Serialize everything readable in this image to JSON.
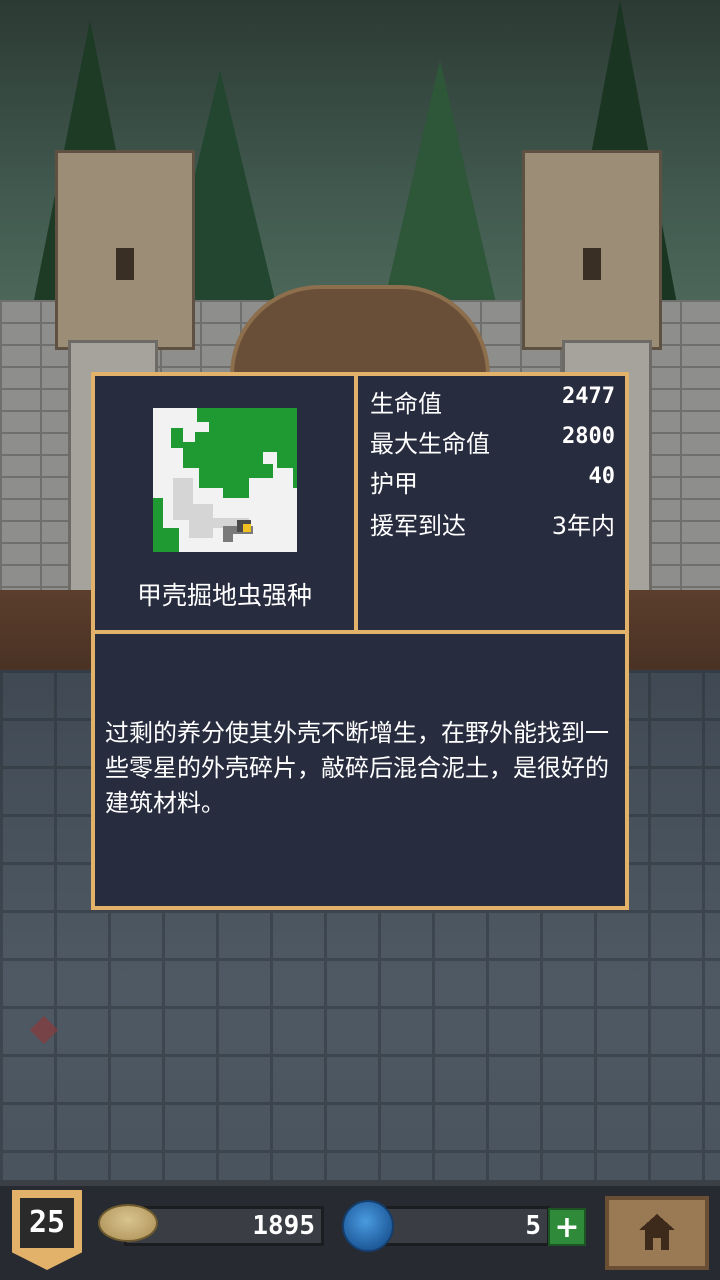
{
  "enemy": {
    "name": "甲壳掘地虫强种",
    "portrait_icon": "armored-burrower-bug-icon"
  },
  "stats": [
    {
      "label": "生命值",
      "value": "2477"
    },
    {
      "label": "最大生命值",
      "value": "2800"
    },
    {
      "label": "护甲",
      "value": "40"
    },
    {
      "label": "援军到达",
      "value": "3年内"
    }
  ],
  "description": "过剩的养分使其外壳不断增生，在野外能找到一些零星的外壳碎片，敲碎后混合泥土，是很好的建筑材料。",
  "hud": {
    "level": "25",
    "gold": "1895",
    "gems": "5",
    "plus_label": "+"
  },
  "colors": {
    "panel_border": "#e2b26a",
    "panel_bg": "#282c3f",
    "portrait_green": "#1f9a32"
  }
}
